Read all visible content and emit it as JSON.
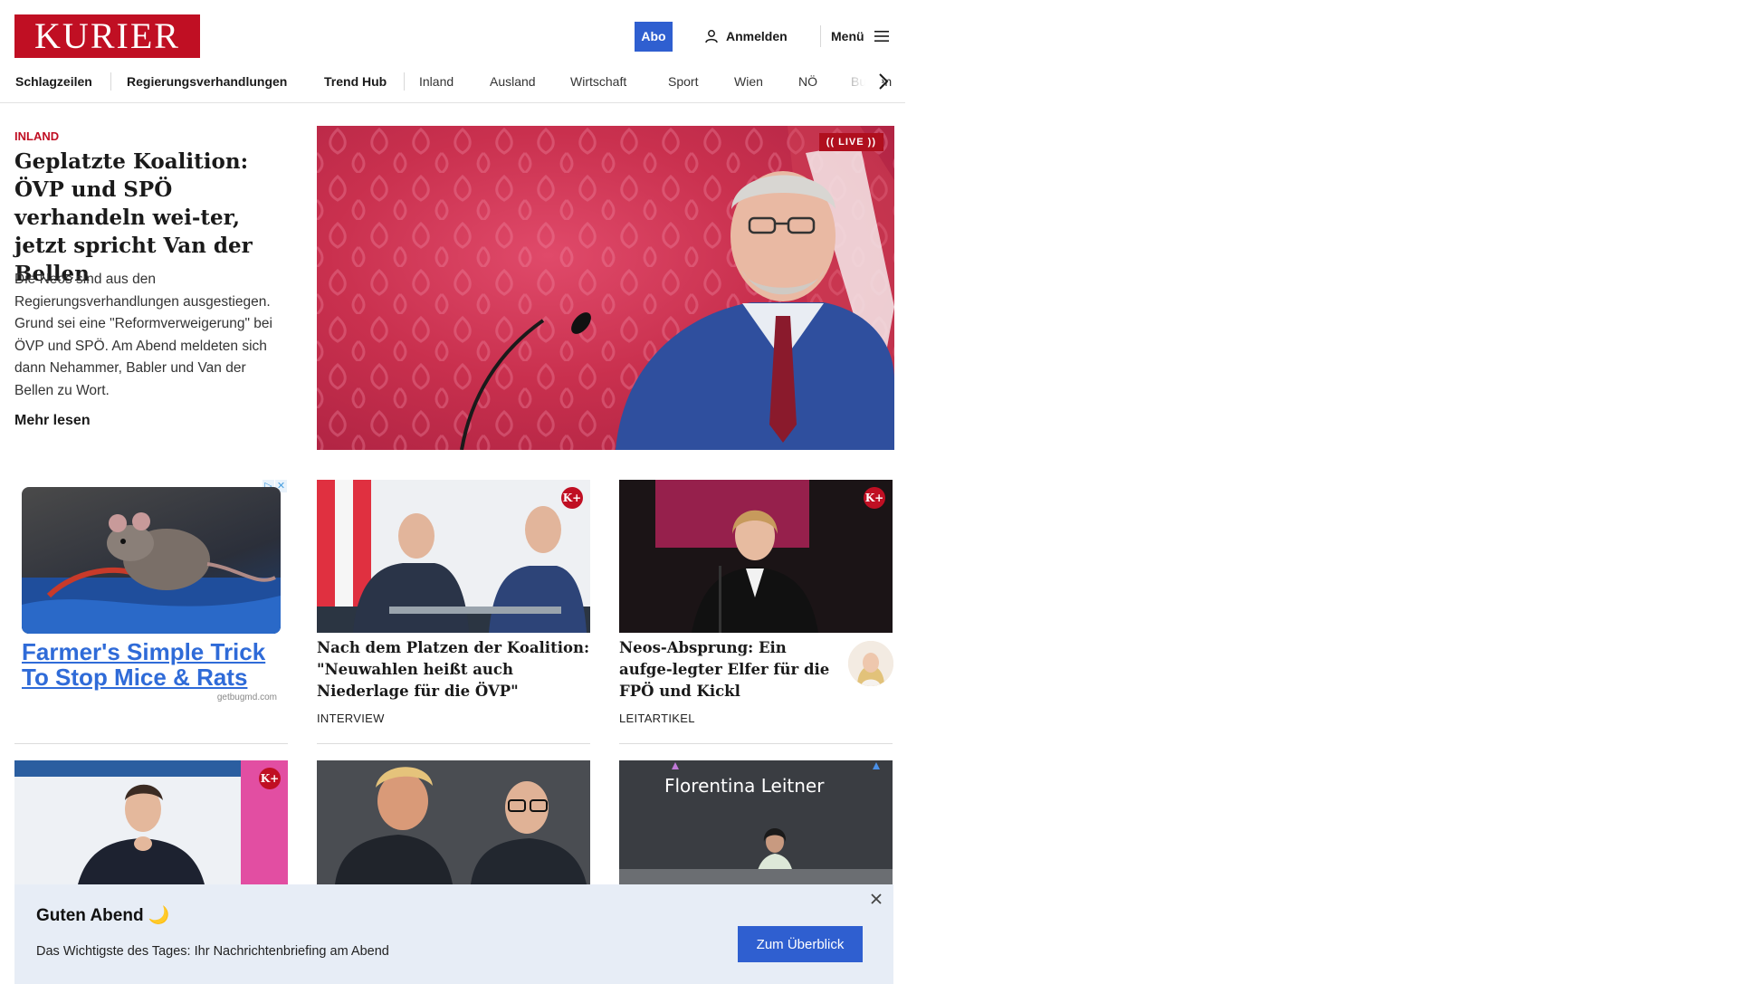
{
  "header": {
    "logo_text": "KURIER",
    "abo_label": "Abo",
    "login_label": "Anmelden",
    "menu_label": "Menü",
    "brand_color": "#c00f23",
    "accent_color": "#2f5fd0"
  },
  "nav": {
    "items": [
      {
        "label": "Schlagzeilen"
      },
      {
        "label": "Regierungsverhandlungen"
      },
      {
        "label": "Trend Hub"
      },
      {
        "label": "Inland"
      },
      {
        "label": "Ausland"
      },
      {
        "label": "Wirtschaft"
      },
      {
        "label": "Sport"
      },
      {
        "label": "Wien"
      },
      {
        "label": "NÖ"
      },
      {
        "label": "Burgenland"
      }
    ],
    "next_icon": "chevron-right-icon"
  },
  "lead": {
    "category": "INLAND",
    "title": "Geplatzte Koalition: ÖVP und SPÖ verhandeln wei-ter, jetzt spricht Van der Bellen",
    "teaser": "Die Neos sind aus den Regierungsverhandlungen ausgestiegen. Grund sei eine \"Reformverweigerung\" bei ÖVP und SPÖ. Am Abend meldeten sich dann Nehammer, Babler und Van der Bellen zu Wort.",
    "more_label": "Mehr lesen",
    "live_label": "LIVE"
  },
  "ad": {
    "headline": "Farmer's Simple Trick To Stop Mice & Rats",
    "source": "getbugmd.com"
  },
  "cards": [
    {
      "title": "Nach dem Platzen der Koalition: \"Neuwahlen heißt auch Niederlage für die ÖVP\"",
      "label": "INTERVIEW",
      "premium_badge": "K+"
    },
    {
      "title": "Neos-Absprung: Ein aufge-legter Elfer für die FPÖ und Kickl",
      "label": "LEITARTIKEL",
      "premium_badge": "K+"
    },
    {
      "premium_badge": "K+"
    },
    {},
    {
      "image_text": "Florentina Leitner"
    }
  ],
  "banner": {
    "title": "Guten Abend 🌙",
    "text": "Das Wichtigste des Tages: Ihr Nachrichtenbriefing am Abend",
    "button_label": "Zum Überblick"
  }
}
